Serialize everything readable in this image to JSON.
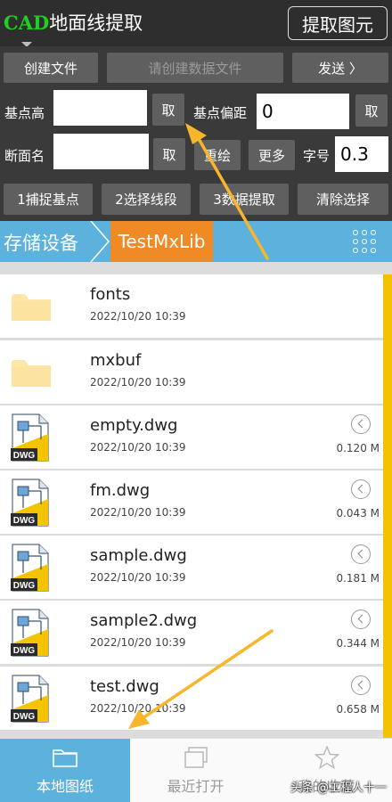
{
  "header": {
    "title_brand": "CAD",
    "title_rest": "地面线提取",
    "extract_button": "提取图元"
  },
  "toolbar": {
    "create_file": "创建文件",
    "data_file_placeholder": "请创建数据文件",
    "send": "发送 〉",
    "base_height_label": "基点高",
    "base_height_value": "",
    "take_1": "取",
    "base_offset_label": "基点偏距",
    "base_offset_value": "0",
    "take_2": "取",
    "section_name_label": "断面名",
    "section_name_value": "",
    "take_3": "取",
    "redraw": "重绘",
    "more": "更多",
    "font_size_label": "字号",
    "font_size_value": "0.3",
    "step1": "1捕捉基点",
    "step2": "2选择线段",
    "step3": "3数据提取",
    "clear_selection": "清除选择"
  },
  "breadcrumb": {
    "root": "存储设备",
    "current": "TestMxLib"
  },
  "files": [
    {
      "name": "fonts",
      "date": "2022/10/20  10:39",
      "size": "",
      "type": "folder"
    },
    {
      "name": "mxbuf",
      "date": "2022/10/20  10:39",
      "size": "",
      "type": "folder"
    },
    {
      "name": "empty.dwg",
      "date": "2022/10/20  10:39",
      "size": "0.120 M",
      "type": "dwg"
    },
    {
      "name": "fm.dwg",
      "date": "2022/10/20  10:39",
      "size": "0.043 M",
      "type": "dwg"
    },
    {
      "name": "sample.dwg",
      "date": "2022/10/20  10:39",
      "size": "0.181 M",
      "type": "dwg"
    },
    {
      "name": "sample2.dwg",
      "date": "2022/10/20  10:39",
      "size": "0.344 M",
      "type": "dwg"
    },
    {
      "name": "test.dwg",
      "date": "2022/10/20  10:39",
      "size": "0.658 M",
      "type": "dwg"
    }
  ],
  "dwg_badge": "DWG",
  "bottom_nav": {
    "local": "本地图纸",
    "recent": "最近打开",
    "favorites": "我的收藏"
  },
  "watermark": "头条 @工程人十一",
  "colors": {
    "accent_blue": "#5cb2dc",
    "accent_orange": "#f08a24",
    "scroll_yellow": "#f2c200",
    "brand_green": "#20d020"
  }
}
